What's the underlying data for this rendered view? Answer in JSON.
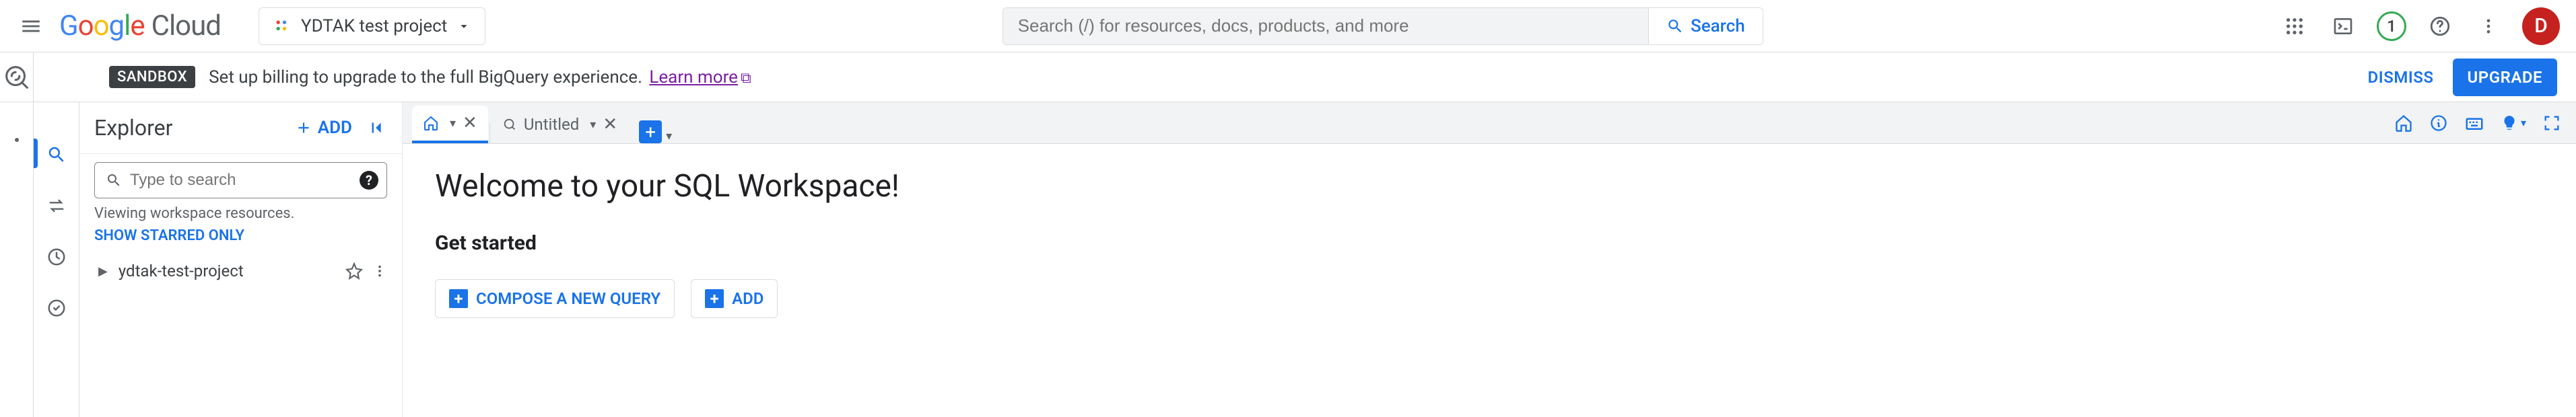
{
  "header": {
    "logo_text_google": "Google",
    "logo_text_cloud": "Cloud",
    "project_name": "YDTAK test project",
    "search_placeholder": "Search (/) for resources, docs, products, and more",
    "search_button": "Search",
    "free_trial_count": "1",
    "avatar_letter": "D"
  },
  "banner": {
    "chip": "SANDBOX",
    "text": "Set up billing to upgrade to the full BigQuery experience.",
    "link": "Learn more",
    "dismiss": "DISMISS",
    "upgrade": "UPGRADE"
  },
  "explorer": {
    "title": "Explorer",
    "add": "ADD",
    "search_placeholder": "Type to search",
    "hint": "Viewing workspace resources.",
    "starred": "SHOW STARRED ONLY",
    "project": "ydtak-test-project"
  },
  "tabs": {
    "untitled": "Untitled"
  },
  "workspace": {
    "title": "Welcome to your SQL Workspace!",
    "subtitle": "Get started",
    "compose": "COMPOSE A NEW QUERY",
    "add": "ADD"
  },
  "icons": {
    "search": "search-icon",
    "apps": "apps-icon",
    "cloudshell": "cloudshell-icon",
    "help": "help-icon",
    "more": "more-icon"
  }
}
